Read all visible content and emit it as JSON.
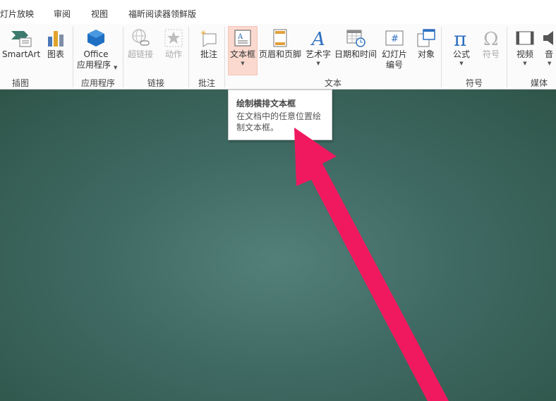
{
  "menu": {
    "tabs": [
      "灯片放映",
      "审阅",
      "视图",
      "福昕阅读器领鲜版"
    ]
  },
  "ribbon": {
    "buttons": {
      "smartart": "SmartArt",
      "chart": "图表",
      "office_line1": "Office",
      "office_line2": "应用程序",
      "hyperlink": "超链接",
      "action": "动作",
      "comment": "批注",
      "textbox": "文本框",
      "header_footer": "页眉和页脚",
      "wordart": "艺术字",
      "datetime": "日期和时间",
      "slide_num_line1": "幻灯片",
      "slide_num_line2": "编号",
      "object": "对象",
      "equation": "公式",
      "symbol": "符号",
      "video": "视频",
      "audio": "音"
    },
    "groups": {
      "illustrations": "插图",
      "apps": "应用程序",
      "links": "链接",
      "comments": "批注",
      "text": "文本",
      "symbols": "符号",
      "media": "媒体"
    }
  },
  "tooltip": {
    "title": "绘制横排文本框",
    "description": "在文档中的任意位置绘制文本框。"
  },
  "colors": {
    "annotation_arrow": "#f0195f",
    "canvas": "#4a7770",
    "active_button": "#fbd9cf"
  }
}
